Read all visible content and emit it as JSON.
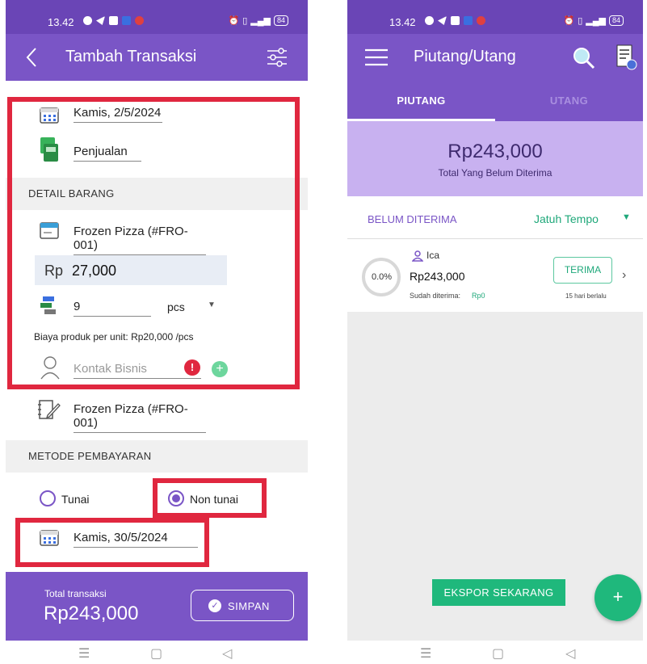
{
  "left": {
    "status": {
      "time": "13.42",
      "battery": "84"
    },
    "appbar": {
      "title": "Tambah Transaksi",
      "back_icon": "chevron-left-icon",
      "settings_icon": "sliders-icon"
    },
    "date_value": "Kamis, 2/5/2024",
    "category_value": "Penjualan",
    "detail_section": "DETAIL BARANG",
    "product_value": "Frozen Pizza  (#FRO-001)",
    "price_currency": "Rp",
    "price_value": "27,000",
    "qty_value": "9",
    "unit_value": "pcs",
    "unit_cost_note": "Biaya produk per unit: Rp20,000 /pcs",
    "contact_placeholder": "Kontak Bisnis",
    "note_value": "Frozen Pizza  (#FRO-001)",
    "payment_section": "METODE PEMBAYARAN",
    "payment_options": [
      "Tunai",
      "Non tunai"
    ],
    "payment_selected": "Non tunai",
    "due_date_value": "Kamis, 30/5/2024",
    "total_label": "Total transaksi",
    "total_value": "Rp243,000",
    "save_label": "SIMPAN",
    "colors": {
      "primary": "#7a55c6",
      "highlight": "#e0273f",
      "accent_green": "#1fb87c"
    }
  },
  "right": {
    "status": {
      "time": "13.42",
      "battery": "84"
    },
    "appbar": {
      "title": "Piutang/Utang",
      "menu_icon": "hamburger-icon",
      "search_icon": "search-icon",
      "report_icon": "report-icon"
    },
    "tabs": [
      "PIUTANG",
      "UTANG"
    ],
    "active_tab": "PIUTANG",
    "summary_amount": "Rp243,000",
    "summary_label": "Total Yang Belum Diterima",
    "filter_left": "BELUM DITERIMA",
    "filter_right": "Jatuh Tempo",
    "item": {
      "name": "Ica",
      "progress_text": "0.0%",
      "progress_value": 0.0,
      "amount": "Rp243,000",
      "received_label": "Sudah diterima:",
      "received_value": "Rp0",
      "action_label": "TERIMA",
      "elapsed": "15 hari berlalu"
    },
    "export_label": "EKSPOR SEKARANG",
    "fab_label": "+"
  },
  "navbar": {
    "menu": "☰",
    "home": "▢",
    "back": "◁"
  }
}
